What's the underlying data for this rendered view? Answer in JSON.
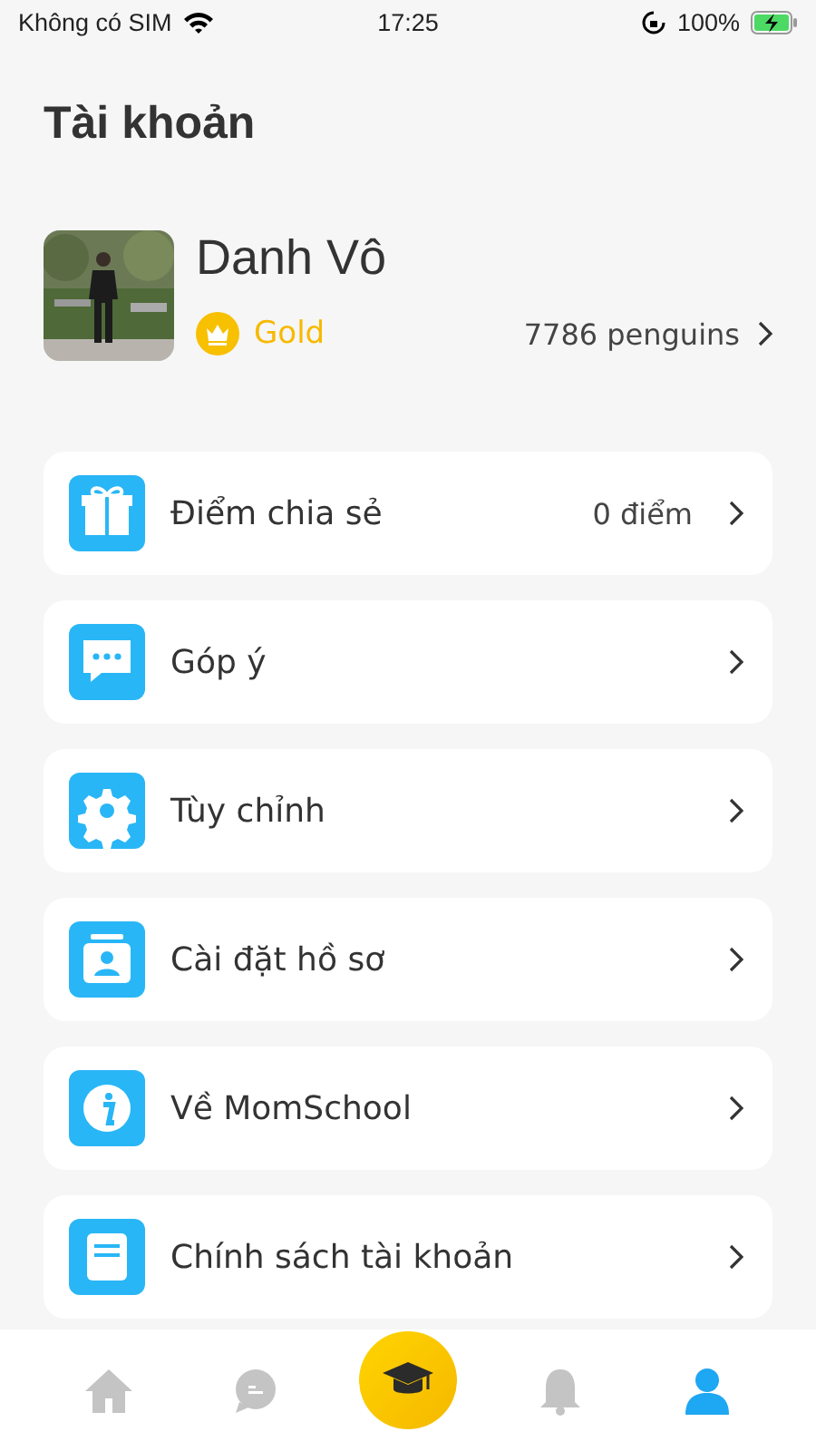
{
  "status_bar": {
    "carrier": "Không có SIM",
    "time": "17:25",
    "battery": "100%"
  },
  "title": "Tài khoản",
  "profile": {
    "name": "Danh Vô",
    "tier": "Gold",
    "points": "7786 penguins"
  },
  "menu": [
    {
      "label": "Điểm chia sẻ",
      "value": "0 điểm"
    },
    {
      "label": "Góp ý"
    },
    {
      "label": "Tùy chỉnh"
    },
    {
      "label": "Cài đặt hồ sơ"
    },
    {
      "label": "Về MomSchool"
    },
    {
      "label": "Chính sách tài khoản"
    }
  ],
  "tabs": [
    {
      "selected": false
    },
    {
      "selected": false
    },
    {
      "selected": false
    },
    {
      "selected": false
    },
    {
      "selected": true
    }
  ]
}
